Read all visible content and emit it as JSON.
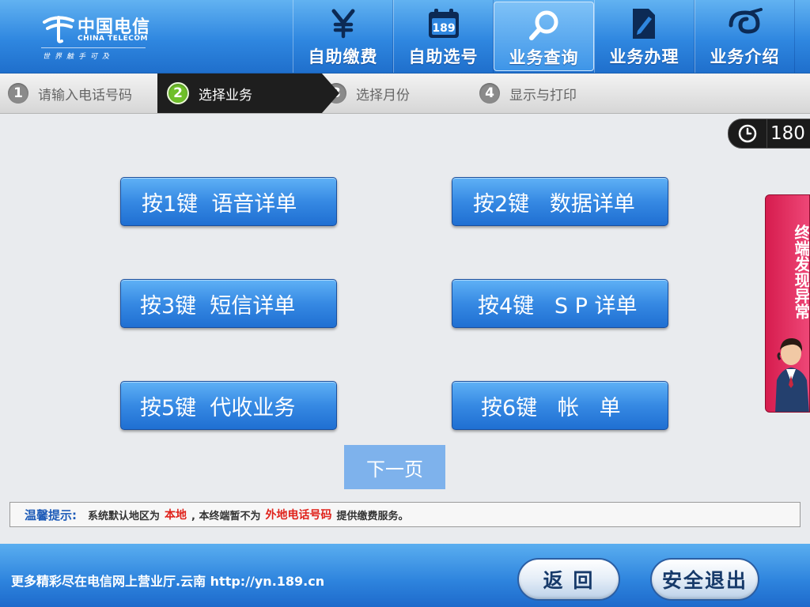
{
  "logo": {
    "cn": "中国电信",
    "en": "CHINA TELECOM",
    "slogan": "世界触手可及"
  },
  "nav": [
    {
      "label": "自助缴费",
      "icon": "yen-icon",
      "active": false
    },
    {
      "label": "自助选号",
      "icon": "calendar-189-icon",
      "icon_text": "189",
      "active": false
    },
    {
      "label": "业务查询",
      "icon": "magnifier-icon",
      "active": true
    },
    {
      "label": "业务办理",
      "icon": "document-pen-icon",
      "active": false
    },
    {
      "label": "业务介绍",
      "icon": "telecom-swirl-icon",
      "active": false
    }
  ],
  "steps": [
    {
      "num": "1",
      "label": "请输入电话号码",
      "active": false
    },
    {
      "num": "2",
      "label": "选择业务",
      "active": true
    },
    {
      "num": "3",
      "label": "选择月份",
      "active": false
    },
    {
      "num": "4",
      "label": "显示与打印",
      "active": false
    }
  ],
  "timer": {
    "value": "180",
    "icon": "clock-icon"
  },
  "options": [
    {
      "label": "按1键  语音详单"
    },
    {
      "label": "按2键   数据详单"
    },
    {
      "label": "按3键  短信详单"
    },
    {
      "label": "按4键   S P 详单"
    },
    {
      "label": "按5键  代收业务"
    },
    {
      "label": "按6键   帐   单"
    }
  ],
  "next_page": "下一页",
  "tip": {
    "title": "温馨提示:",
    "part1": "系统默认地区为",
    "highlight1": "本地",
    "part2": ",  本终端暂不为",
    "highlight2": "外地电话号码",
    "part3": "提供缴费服务。"
  },
  "side_panel": {
    "text": "终端发现异常"
  },
  "footer": {
    "text": "更多精彩尽在电信网上营业厅.云南  http://yn.189.cn",
    "back_label": "返 回",
    "exit_label": "安全退出"
  },
  "colors": {
    "header_blue": "#2f87e0",
    "button_blue": "#3689e3",
    "alert_red": "#e0221b",
    "side_pink": "#e33366"
  }
}
